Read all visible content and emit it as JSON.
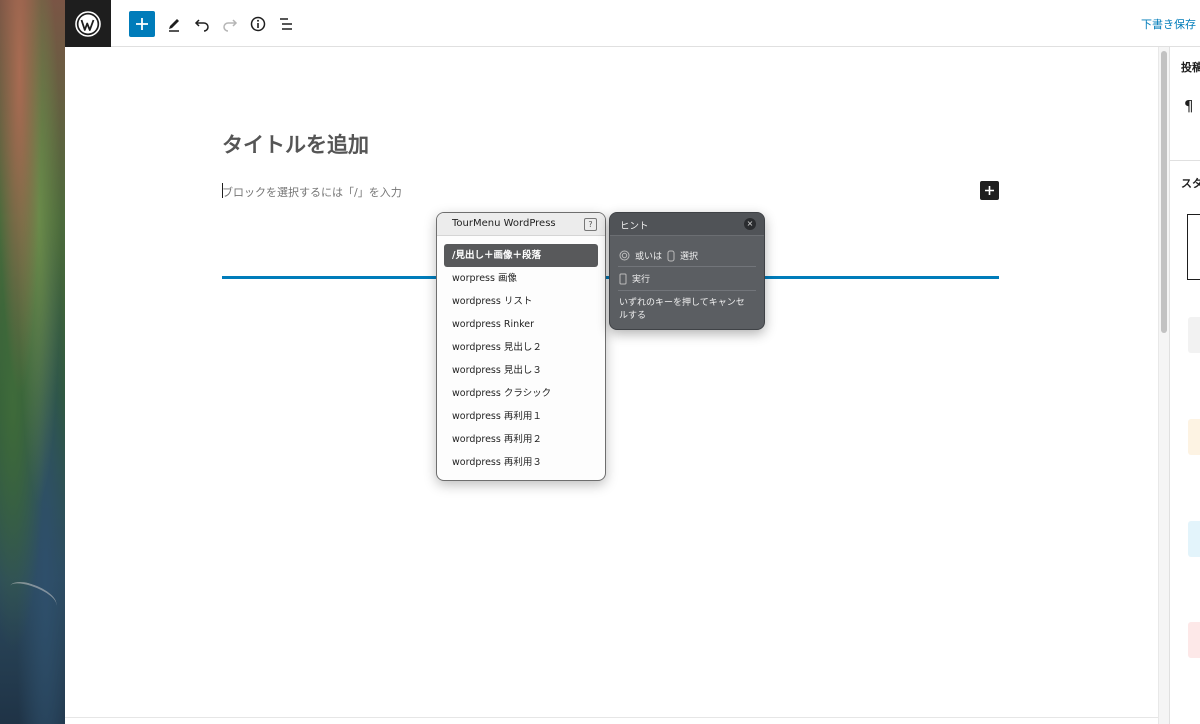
{
  "toolbar": {
    "logo_icon": "wordpress-logo-icon",
    "add_block_icon": "plus-icon",
    "tools_icon": "pencil-icon",
    "undo_icon": "undo-icon",
    "redo_icon": "redo-icon",
    "details_icon": "info-icon",
    "outline_icon": "list-view-icon",
    "save_draft": "下書き保存"
  },
  "editor": {
    "title_placeholder": "タイトルを追加",
    "block_placeholder": "ブロックを選択するには「/」を入力"
  },
  "sidebar": {
    "tab_label": "投稿",
    "paragraph_icon": "¶",
    "styles_label": "スタ"
  },
  "tourmenu": {
    "title": "TourMenu WordPress",
    "help": "?",
    "items": [
      "/見出し＋画像＋段落",
      "worpress 画像",
      "wordpress リスト",
      "wordpress Rinker",
      "wordpress 見出し２",
      "wordpress 見出し３",
      "wordpress クラシック",
      "wordpress 再利用１",
      "wordpress 再利用２",
      "wordpress 再利用３"
    ],
    "selected_index": 0
  },
  "hint": {
    "title": "ヒント",
    "close": "×",
    "select_prefix": "或いは",
    "select_label": "選択",
    "execute_label": "実行",
    "cancel_text": "いずれのキーを押してキャンセルする"
  },
  "colors": {
    "accent": "#007cba",
    "dark": "#1e1e1e",
    "menu_selected": "#58595b",
    "hint_bg": "#5b5e62"
  }
}
